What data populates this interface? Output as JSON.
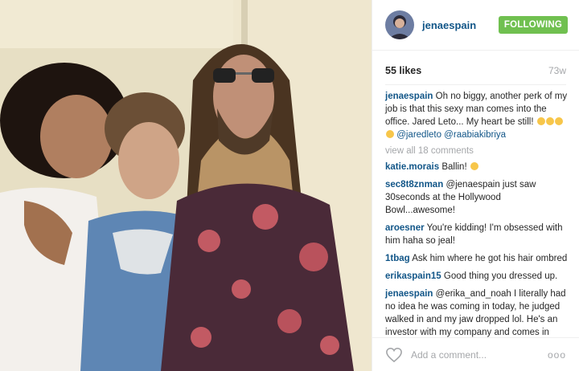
{
  "post": {
    "username": "jenaespain",
    "follow_label": "FOLLOWING",
    "likes": "55 likes",
    "time_ago": "73w",
    "caption": {
      "username": "jenaespain",
      "text": "Oh no biggy, another perk of my job is that this sexy man comes into the office. Jared Leto... My heart be still!",
      "mentions": "@jaredleto @raabiakibriya"
    },
    "view_all": "view all 18 comments",
    "comments": [
      {
        "username": "katie.morais",
        "text": "Ballin!"
      },
      {
        "username": "sec8t8znman",
        "text": "@jenaespain just saw 30seconds at the Hollywood Bowl...awesome!"
      },
      {
        "username": "aroesner",
        "text": "You're kidding! I'm obsessed with him haha so jeal!"
      },
      {
        "username": "1tbag",
        "text": "Ask him where he got his hair ombred"
      },
      {
        "username": "erikaspain15",
        "text": "Good thing you dressed up."
      },
      {
        "username": "jenaespain",
        "text": "@erika_and_noah I literally had no idea he was coming in today, he judged walked in and my jaw dropped lol. He's an investor with my company and comes in fairly often."
      }
    ],
    "add_comment_placeholder": "Add a comment...",
    "more_label": "ooo"
  },
  "colors": {
    "username": "#125688",
    "follow_button": "#70c050",
    "muted": "#a5a7aa"
  },
  "icons": {
    "like": "heart-outline-icon",
    "more": "more-options-icon"
  }
}
